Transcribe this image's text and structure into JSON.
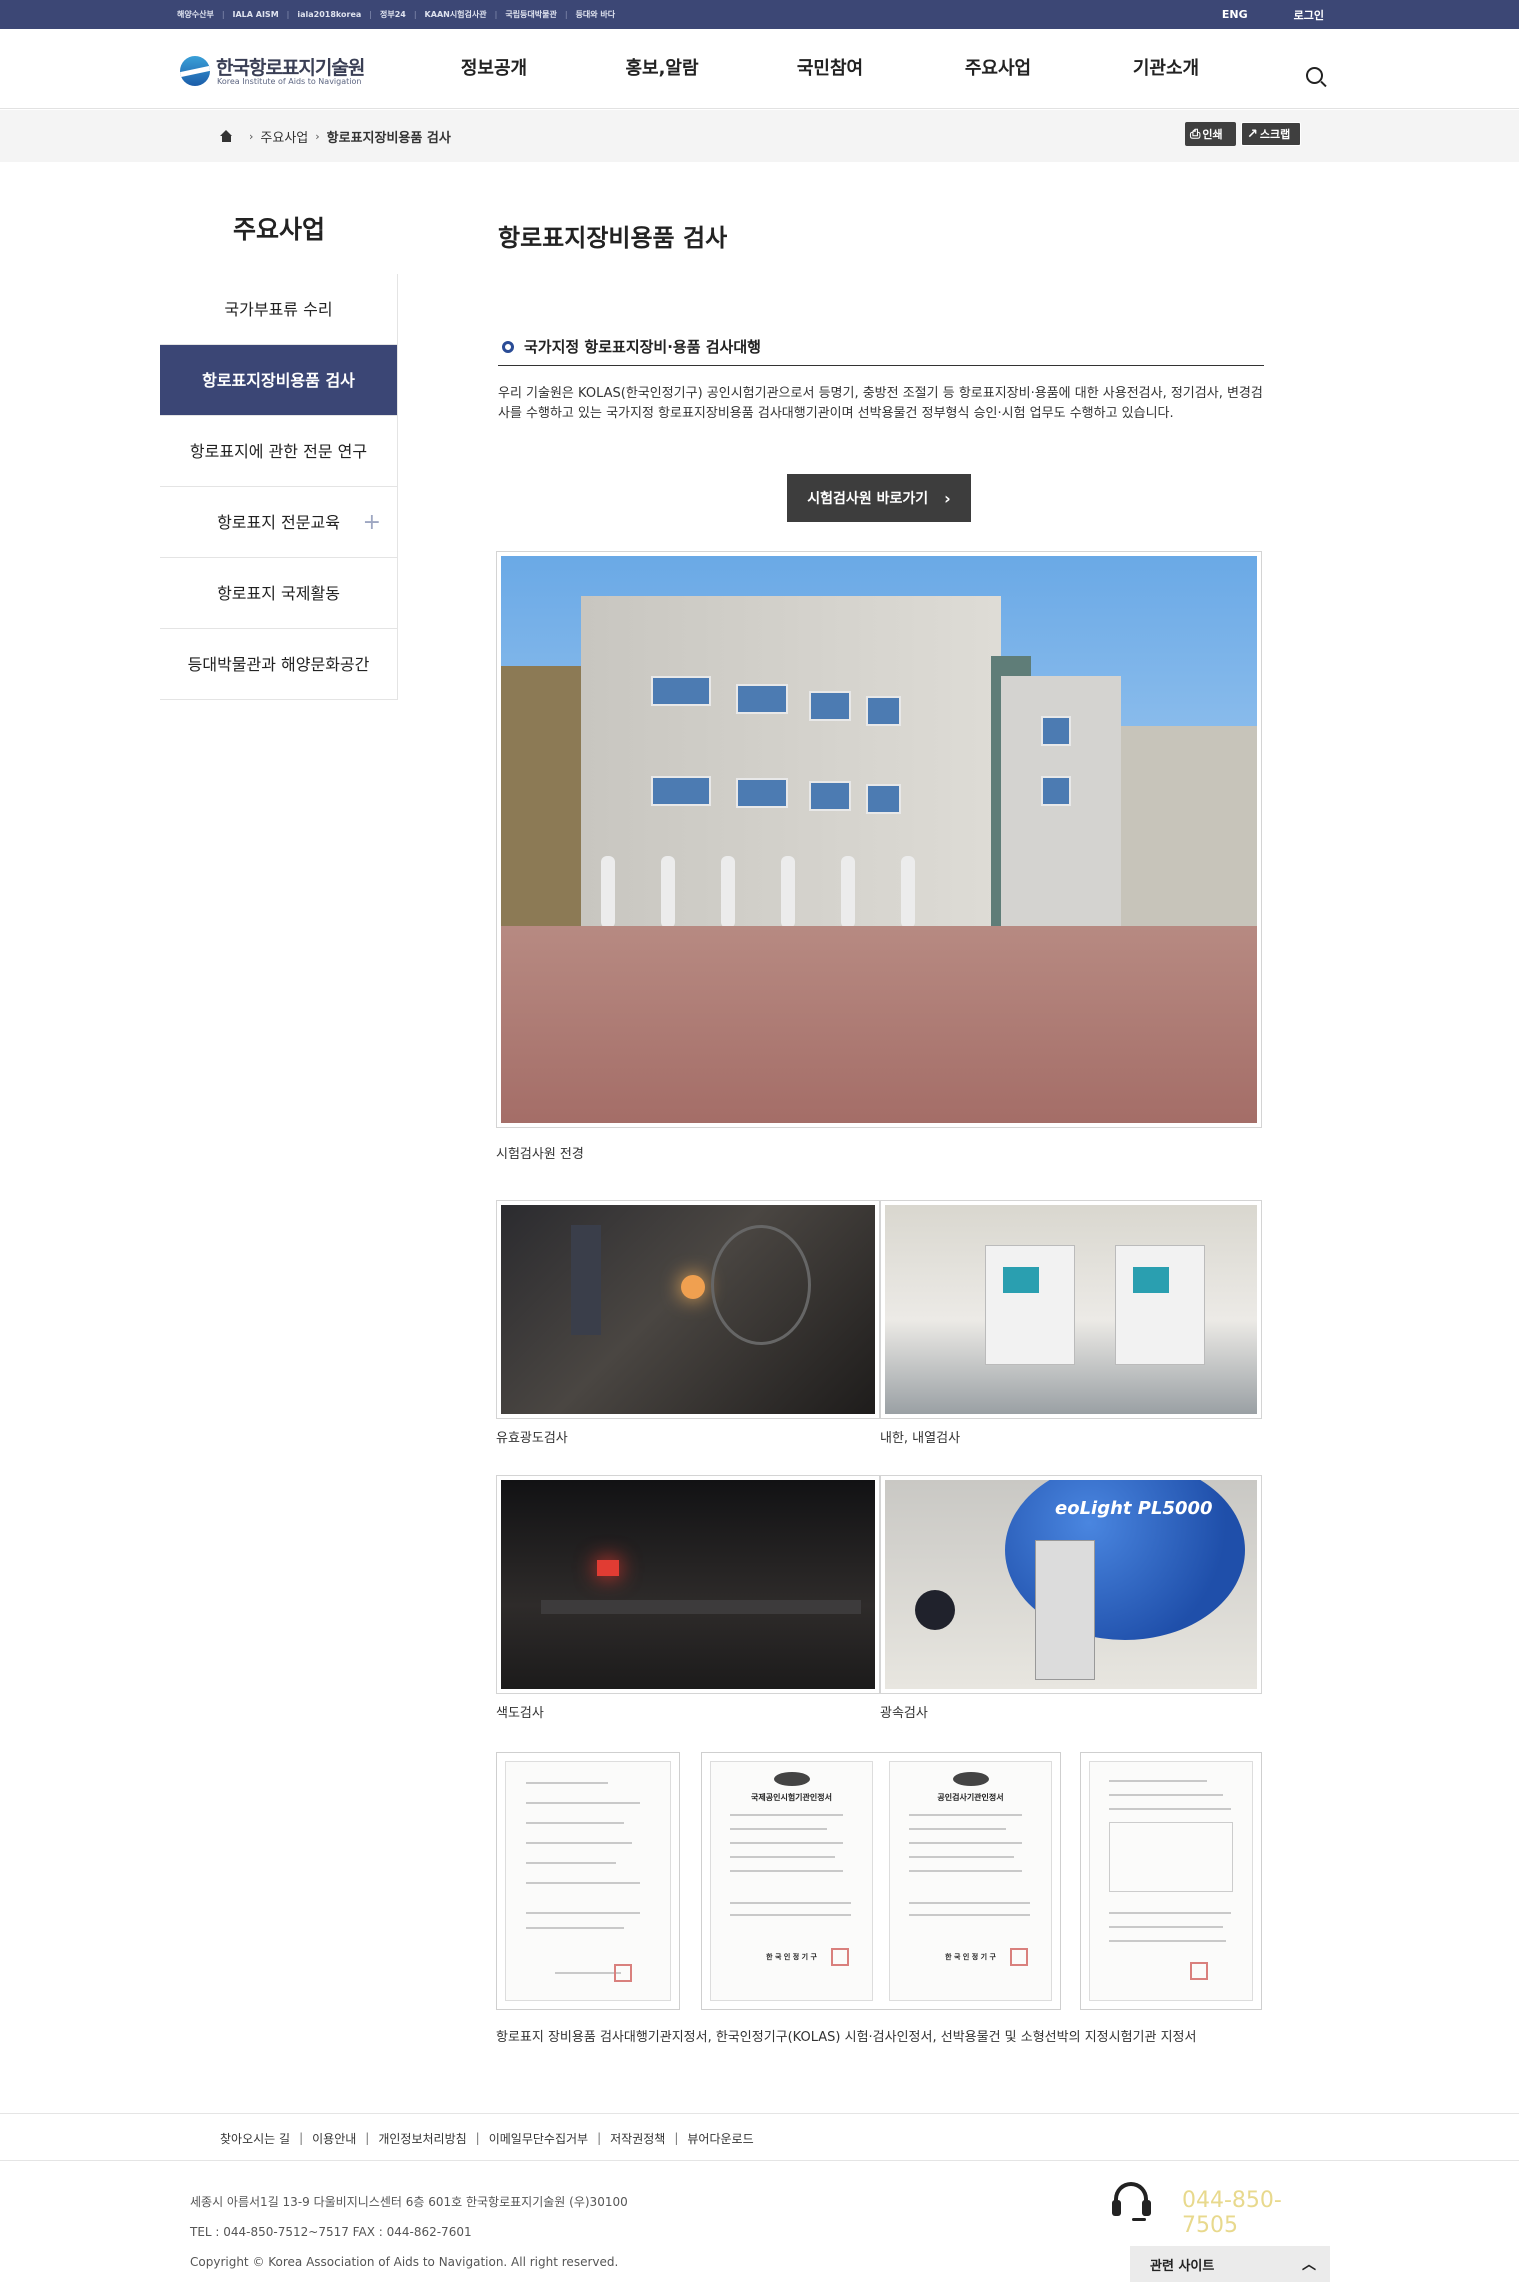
{
  "topbar": {
    "links": [
      "해양수산부",
      "IALA AISM",
      "iala2018korea",
      "정부24",
      "KAAN시험검사관",
      "국립등대박물관",
      "등대와 바다"
    ],
    "lang": "ENG",
    "login": "로그인"
  },
  "header": {
    "logo_ko": "한국항로표지기술원",
    "logo_en": "Korea Institute of Aids to Navigation",
    "nav": [
      "정보공개",
      "홍보,알람",
      "국민참여",
      "주요사업",
      "기관소개"
    ]
  },
  "breadcrumb": {
    "items": [
      "주요사업",
      "항로표지장비용품 검사"
    ],
    "print_label": "인쇄",
    "scrap_label": "스크랩"
  },
  "sidebar": {
    "title": "주요사업",
    "items": [
      {
        "label": "국가부표류 수리"
      },
      {
        "label": "항로표지장비용품 검사"
      },
      {
        "label": "항로표지에 관한 전문 연구"
      },
      {
        "label": "항로표지 전문교육"
      },
      {
        "label": "항로표지 국제활동"
      },
      {
        "label": "등대박물관과 해양문화공간"
      }
    ],
    "expand_symbol": "+"
  },
  "content": {
    "page_title": "항로표지장비용품 검사",
    "section_title": "국가지정 항로표지장비·용품 검사대행",
    "intro": "우리 기술원은 KOLAS(한국인정기구) 공인시험기관으로서 등명기, 충방전 조절기 등 항로표지장비·용품에 대한 사용전검사, 정기검사, 변경검사를 수행하고 있는 국가지정 항로표지장비용품 검사대행기관이며 선박용물건 정부형식 승인·시험 업무도 수행하고 있습니다.",
    "button_label": "시험검사원 바로가기",
    "captions": {
      "building": "시험검사원 전경",
      "photo1": "유효광도검사",
      "photo2": "내한, 내열검사",
      "photo3": "색도검사",
      "photo4": "광속검사",
      "certs": "항로표지 장비용품 검사대행기관지정서, 한국인정기구(KOLAS) 시험·검사인정서, 선박용물건 및 소형선박의 지정시험기관 지정서"
    },
    "cert_titles": [
      "국제공인시험기관인정서",
      "공인검사기관인정서"
    ],
    "cert_issuer": "한 국 인 정 기 구",
    "sphere_label": "eoLight PL5000"
  },
  "footer": {
    "links": [
      "찾아오시는 길",
      "이용안내",
      "개인정보처리방침",
      "이메일무단수집거부",
      "저작권정책",
      "뷰어다운로드"
    ],
    "address": "세종시 아름서1길 13-9 다울비지니스센터 6층 601호 한국항로표지기술원 (우)30100",
    "tel_fax": "TEL : 044-850-7512~7517 FAX : 044-862-7601",
    "copyright": "Copyright © Korea Association of Aids to Navigation. All right reserved.",
    "phone": "044-850-7505",
    "related_sites": "관련 사이트"
  }
}
